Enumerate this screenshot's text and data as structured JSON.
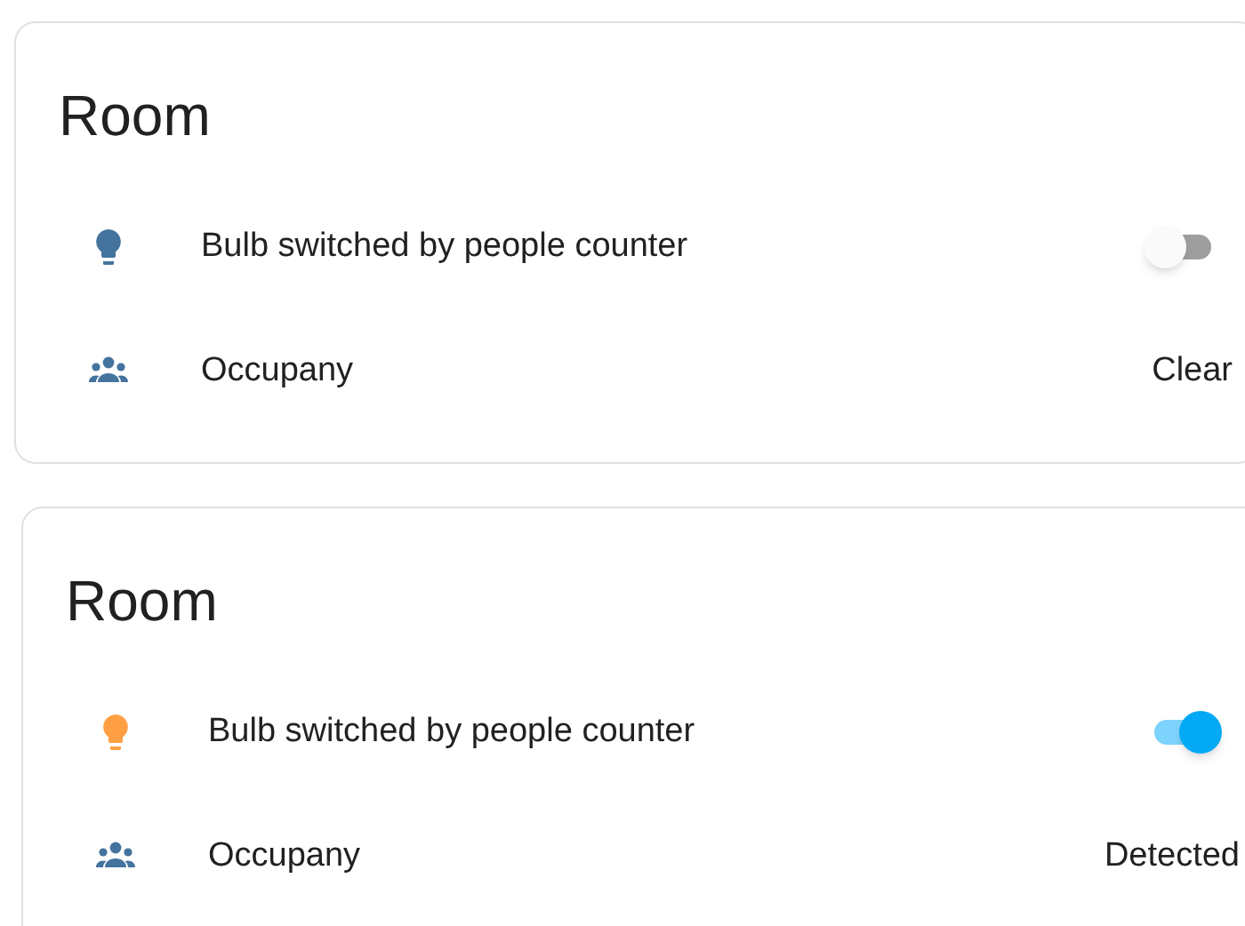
{
  "cards": [
    {
      "title": "Room",
      "rows": [
        {
          "kind": "switch",
          "label": "Bulb switched by people counter",
          "on": false
        },
        {
          "kind": "sensor",
          "label": "Occupany",
          "value": "Clear"
        }
      ]
    },
    {
      "title": "Room",
      "rows": [
        {
          "kind": "switch",
          "label": "Bulb switched by people counter",
          "on": true
        },
        {
          "kind": "sensor",
          "label": "Occupany",
          "value": "Detected"
        }
      ]
    }
  ]
}
